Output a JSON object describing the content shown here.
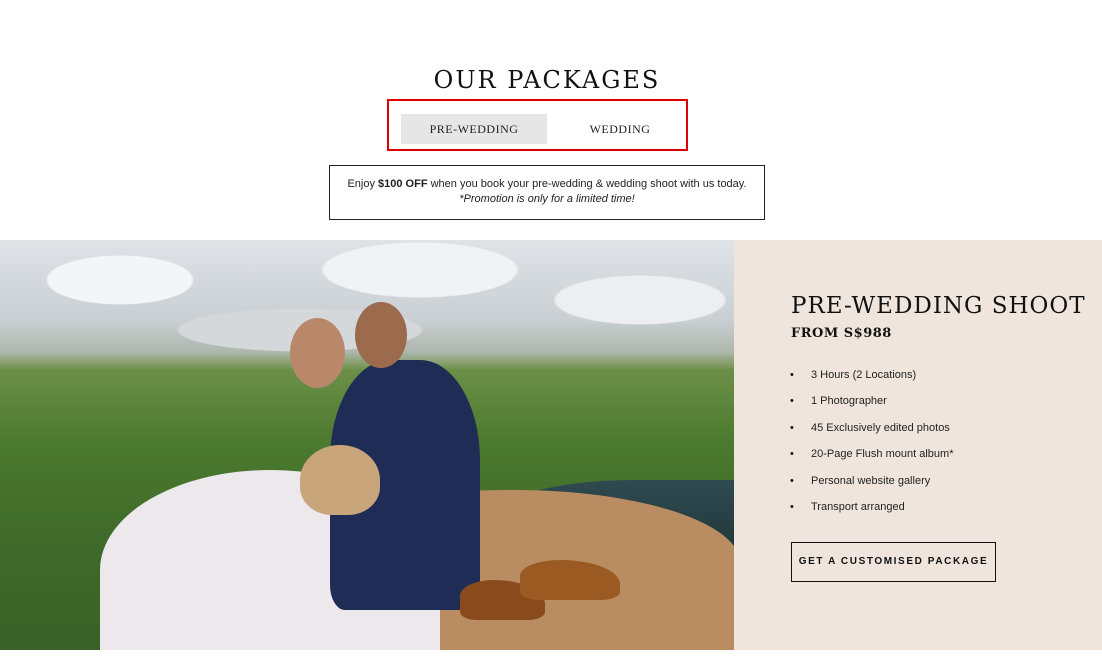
{
  "section": {
    "title": "OUR PACKAGES"
  },
  "tabs": [
    {
      "label": "PRE-WEDDING",
      "active": true
    },
    {
      "label": "WEDDING",
      "active": false
    }
  ],
  "promo": {
    "prefix": "Enjoy ",
    "highlight": "$100 OFF",
    "suffix": " when you book your pre-wedding & wedding shoot with us today.",
    "note": "*Promotion is only for a limited time!"
  },
  "colors": {
    "panel_bg": "#efe5dd",
    "highlight_border": "#e00000",
    "active_tab_bg": "#e6e6e6"
  },
  "package": {
    "title": "PRE-WEDDING SHOOT",
    "price": "FROM S$988",
    "features": [
      "3 Hours (2 Locations)",
      "1 Photographer",
      "45 Exclusively edited photos",
      "20-Page Flush mount album*",
      "Personal website gallery",
      "Transport arranged"
    ],
    "cta_label": "GET A CUSTOMISED PACKAGE"
  }
}
